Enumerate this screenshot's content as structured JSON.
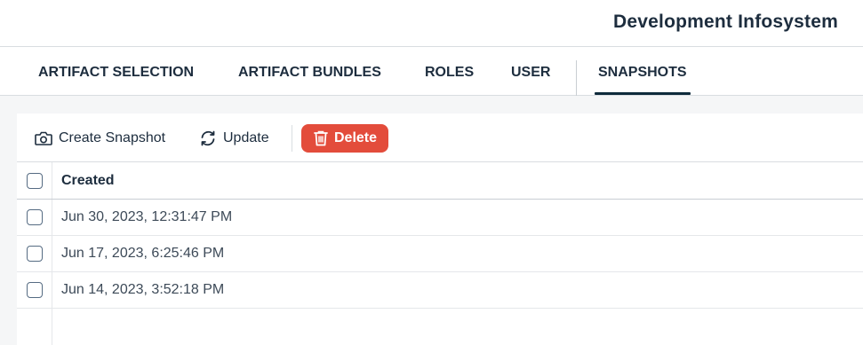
{
  "header": {
    "title": "Development Infosystem"
  },
  "tabs": [
    {
      "label": "ARTIFACT SELECTION",
      "active": false
    },
    {
      "label": "ARTIFACT BUNDLES",
      "active": false
    },
    {
      "label": "ROLES",
      "active": false
    },
    {
      "label": "USER",
      "active": false
    },
    {
      "label": "SNAPSHOTS",
      "active": true
    }
  ],
  "toolbar": {
    "create_label": "Create Snapshot",
    "create_icon": "camera-icon",
    "update_label": "Update",
    "update_icon": "refresh-icon",
    "delete_label": "Delete",
    "delete_icon": "trash-icon",
    "delete_color": "#e34c3b"
  },
  "table": {
    "columns": [
      "Created"
    ],
    "rows": [
      {
        "created": "Jun 30, 2023, 12:31:47 PM"
      },
      {
        "created": "Jun 17, 2023, 6:25:46 PM"
      },
      {
        "created": "Jun 14, 2023, 3:52:18 PM"
      }
    ]
  },
  "colors": {
    "text": "#1d2d3e",
    "accent": "#0e2a3b",
    "background": "#f5f6f7"
  }
}
